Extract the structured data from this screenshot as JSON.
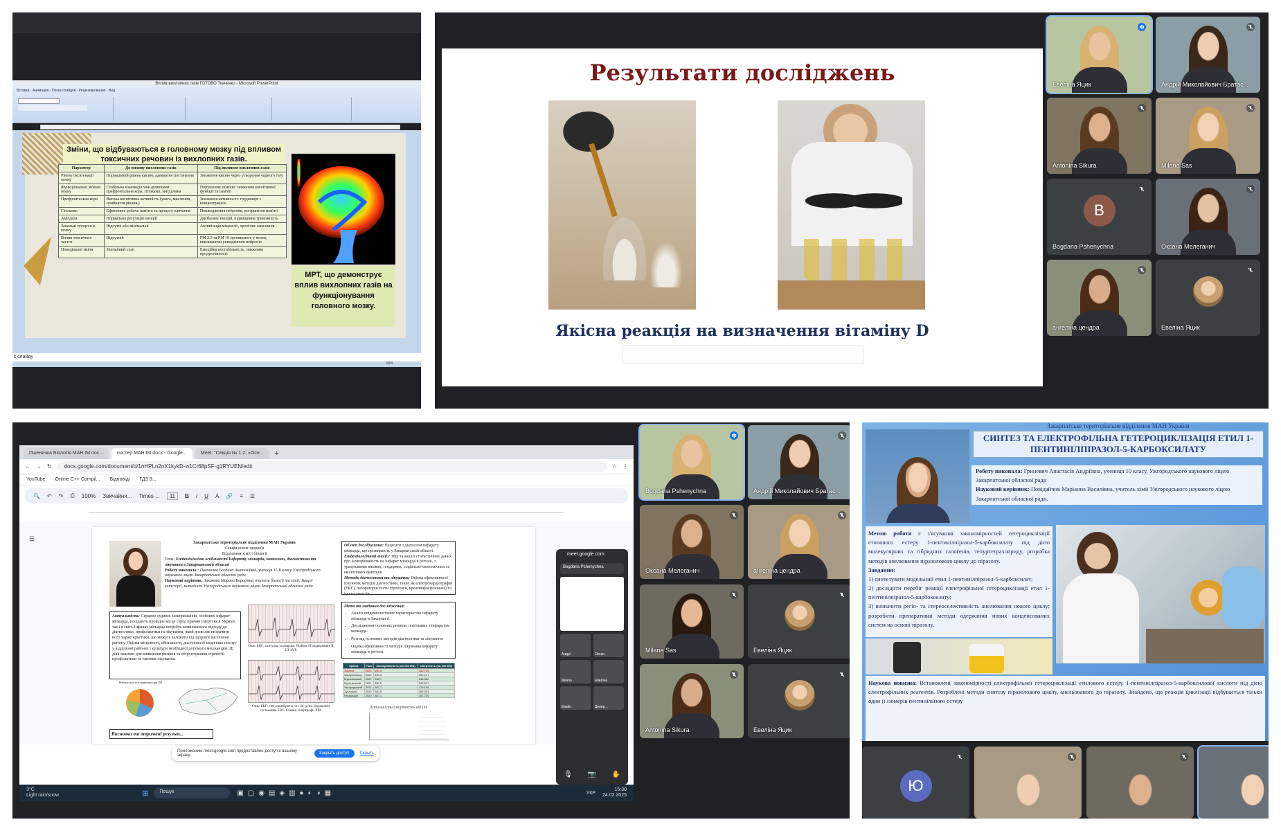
{
  "panel1": {
    "ppt_window_title": "Вплив вихлопних газів ГОТОВО Ткаченко - Microsoft PowerPoint",
    "ribbon_tabs": "Вставка · Анимация · Показ слайдов · Рецензирование · Вид",
    "slide_heading": "Зміни, що відбуваються в головному мозку під впливом токсичних речовин із вихлопних газів.",
    "table": {
      "headers": [
        "Параметр",
        "До впливу вихлопних газів",
        "Під впливом вихлопних газів"
      ],
      "rows": [
        [
          "Рівень оксигенації мозку",
          "Нормальний рівень кисню, адекватне постачання",
          "Зниження кисню через утворення чадного газу"
        ],
        [
          "Функціональні зв'язки мозку",
          "Стабільна взаємодія між ділянками: префронтальна кора, гіпокамп, мигдалина",
          "Порушення зв'язків: зниження когнітивної функції та пам'яті"
        ],
        [
          "Префронтальна кора",
          "Висока когнітивна активність (увага, мислення, прийняття рішень)",
          "Зниження активності: труднощів з концентрацією"
        ],
        [
          "Гіпокамп",
          "Ефективне робоча пам'ять та процесу навчання",
          "Пошкодження нейронів, погіршення пам'яті"
        ],
        [
          "Амігдала",
          "Нормальна регуляція емоцій",
          "Дисбаланс емоцій, підвищення тривожність"
        ],
        [
          "Запальні процеси в мозку",
          "Відсутні або мінімальні",
          "Активізація мікроглії, хронічне запалення"
        ],
        [
          "Вплив токсичних частот",
          "Відсутній",
          "PM 2.5 та PM 10 проникають у мозок, викликаючи ушкодження нейронів"
        ],
        [
          "Поведінкові зміни",
          "Звичайний стан",
          "Емоційна нестабільність, зниження продуктивності"
        ]
      ]
    },
    "mri_caption": "МРТ, що демонструє вплив вихлопних газів на функціонування головного мозку.",
    "status_text": "к слайду",
    "zoom": "65%"
  },
  "panel2": {
    "slide_title": "Результати досліджень",
    "slide_subtitle": "Якісна реакція на визначення вітаміну D",
    "participants": [
      {
        "name": "Евеліна Яцик",
        "active": true
      },
      {
        "name": "Андрій Миколайович Братас..."
      },
      {
        "name": "Antonina Sikura"
      },
      {
        "name": "Milana Sas"
      },
      {
        "name": "Bogdana Pshenychna",
        "initial": "B",
        "color": "#8d5a4a"
      },
      {
        "name": "Оксана Мелеганич"
      },
      {
        "name": "ангеліна цендра"
      },
      {
        "name": "Евеліна Яцик"
      }
    ]
  },
  "panel3": {
    "browser_tabs": [
      "Пшеничка Біологія МАН ІМ пос...",
      "постер МАН ІМ.docx - Google...",
      "Meet: \"Секція № 1.2, «Осн..."
    ],
    "url": "docs.google.com/document/d/1nHPLn2oX1kykD-w1Cr68pSF-g1RYUEN/edit",
    "bookmarks": [
      "YouTube",
      "Online C++ Compil...",
      "Відповіді",
      "ГДЗ З..."
    ],
    "toolbar": {
      "zoom": "100%",
      "style": "Звичайни...",
      "font": "Times ...",
      "size": "11"
    },
    "doc": {
      "header_line1": "Закарпатське територіальне відділення МАН України",
      "header_line2": "Секція основ здоров'я",
      "header_line3": "Відділення хімії і біології",
      "theme_label": "Тема:",
      "theme": "Епідеміологічні особливості Інфаркту міокарда, патогенез, діагностика та лікування в Закарпатській області",
      "author_label": "Роботу виконала :",
      "author": "Пшенична Богдана Анатоліївна, учениця 11-Б класу Ужгородського наукового ліцею Закарпатської обласної ради",
      "supervisor_label": "Науковий керівник:",
      "supervisor": "Зиканова Марина Борисівна, вчитель біології та хімії; Вищої категорії, методист Ужгородського наукового ліцею Закарпатської обласної ради",
      "relevance_label": "Актуальність:",
      "relevance": "Серцево-судинні захворювання, особливо інфаркт міокарда, посідають провідне місце серед причин смерті як в Україні, так і в світі. Інфаркт міокарда потребує комплексного підходу до діагностики, профілактики та лікування, який дозволяє визначити його характеристики, що можуть залежати від здоров'я населення регіону. Оцінка місцевості, обізнаності, доступності медичних послуг у відділенні районах і культури необхідної допомоги мешканцям. Ці дані важливі для виявлення ризиків та обґрунтування стратегій профілактики та тактики лікування.",
      "object_label": "Об'єкт дослідження:",
      "object": "Пацієнти з діагнозом інфаркту міокарда, що проживають у Закарпатській області.",
      "epi_label": "Епідеміологічний аналіз:",
      "epi": "Збір та аналіз статистичних даних про захворюваність на інфаркт міокарда в регіоні, з урахуванням вікових, гендерних, соціально-економічних та екологічних факторів.",
      "methods_label": "Методи діагностики та лікування:",
      "methods": "Оцінка ефективності існуючих методів діагностики, таких як електрокардіографія (ЕКГ), лабораторні тести (тропонін, креатинфосфокіназа) та інших методів.",
      "tasks_label": "Мета та завдання дослідження:",
      "tasks": [
        "Аналіз епідеміологічних характеристик інфаркту міокарда в Закарпатті.",
        "Дослідження основних ризиків, пов'язаних з інфарктом міокарда.",
        "Розгляд основних методів діагностики та лікування.",
        "Оцінка ефективності методів лікування інфаркту міокарда в регіоні."
      ],
      "ecg1_caption": "Опис ЕКГ: синусова тахікардія. Підйом ST відведеннях ІІ, ІІІ, aVF.",
      "ecg2_caption": "Опис ЕКГ: синусовий ритм, чсс 68 уд/хв. Нормальне положення ЕВС. Ознаки гіпертрофії ЛШ.",
      "chart_title": "Летальність/смертність від ІМ",
      "pie_title": "Найчастіші ускладнення при ІМ",
      "conclusions_label": "Висновки та отримані результ...",
      "table_headers": [
        "Країна",
        "Роки",
        "Захворюваність (на 100 000)",
        "Смертність (на 100 000)"
      ],
      "table_rows": [
        [
          "Україна",
          "2023",
          "400,5",
          "350,755"
        ],
        [
          "Закарпатська",
          "2022",
          "420,3",
          "590,217"
        ],
        [
          "Мукачівський",
          "2022",
          "398,7",
          "548,302"
        ],
        [
          "Берегівський",
          "2021",
          "350,2",
          "525,617"
        ],
        [
          "Ужгородський",
          "2021",
          "367,7",
          "179,169"
        ],
        [
          "Хустський",
          "2020",
          "380,5",
          "369,003"
        ],
        [
          "Рахівський",
          "2020",
          "387,1",
          "201,729"
        ]
      ]
    },
    "share_bar": {
      "text": "Приложению meet.google.com предоставлен доступ к вашему экрану.",
      "stop": "Закрыть доступ",
      "hide": "Скрыть"
    },
    "popup_url": "meet.google.com",
    "popup_tiles": [
      "Bogdana Pshenychna",
      "Андрі",
      "Оксан",
      "Milana",
      "Евеліна",
      "Еваlin",
      "Депер..."
    ],
    "taskbar": {
      "weather_temp": "3°C",
      "weather": "Light rain/snow",
      "search": "Пошук",
      "lang": "УКР",
      "time": "15:30",
      "date": "24.02.2025"
    },
    "participants": [
      {
        "name": "Bogdana Pshenychna",
        "active": true
      },
      {
        "name": "Андрій Миколайович Братас..."
      },
      {
        "name": "Оксана Мелеганич"
      },
      {
        "name": "ангеліна цендра"
      },
      {
        "name": "Milana Sas"
      },
      {
        "name": "Евеліна Яцик"
      },
      {
        "name": "Antonina Sikura"
      },
      {
        "name": "Евеліна Яцик"
      }
    ]
  },
  "panel4": {
    "poster_top": "Закарпатське територіальне відділення МАН України",
    "poster_title": "СИНТЕЗ ТА ЕЛЕКТРОФІЛЬНА ГЕТЕРОЦИКЛІЗАЦІЯ ЕТИЛ 1-ПЕНТИНІЛПІРАЗОЛ-5-КАРБОКСИЛАТУ",
    "author_label": "Роботу виконала:",
    "author": "Гриневич Анастасія Андріївна, учениця 10 класу, Ужгородського наукового ліцею Закарпатської обласної ради",
    "supervisor_label": "Науковий керівник:",
    "supervisor": "Повідайчик Маріанна Василівна, учитель хімії Ужгородського наукового ліцею Закарпатської обласної ради.",
    "method_label": "Метою роботи",
    "method": "є з'ясування закономірностей гетероциклізації етилового естеру 1-пентинілпіразол-5-карбоксилату під дією молекулярних та гібридних галогенів, телуртетрахлориду, розробка методів анелювання піразолового циклу до піразолу.",
    "tasks_label": "Завдання:",
    "tasks": [
      "1) синтезувати модельний етил 1-пентинілпіразол-5-карбоксилат;",
      "2) дослідити перебіг реакції електрофільної гетероциклізації етил 1-пентинілпіразол-5-карбоксилату;",
      "3) визначити регіо- та стереоселективність анелювання нового циклу; розробити препаративні методи одержання нових конденсованих систем на основі піразолу."
    ],
    "novelty_label": "Наукова новизна:",
    "novelty": "Встановлені закономірності електрофільної гетероциклізації етилового естеру 1-пентинілпіразол-5-карбоксилової кислоти під дією електрофільних реагентів. Розроблені методи синтезу піразолового циклу, анельованого до піразолу. Знайдено, що реакція циклізації відбувається тільки один (і ізомерів пентинільного естеру",
    "bottom_tiles": [
      {
        "initial": "Ю",
        "color": "#5b6bc0"
      },
      {},
      {},
      {}
    ]
  }
}
